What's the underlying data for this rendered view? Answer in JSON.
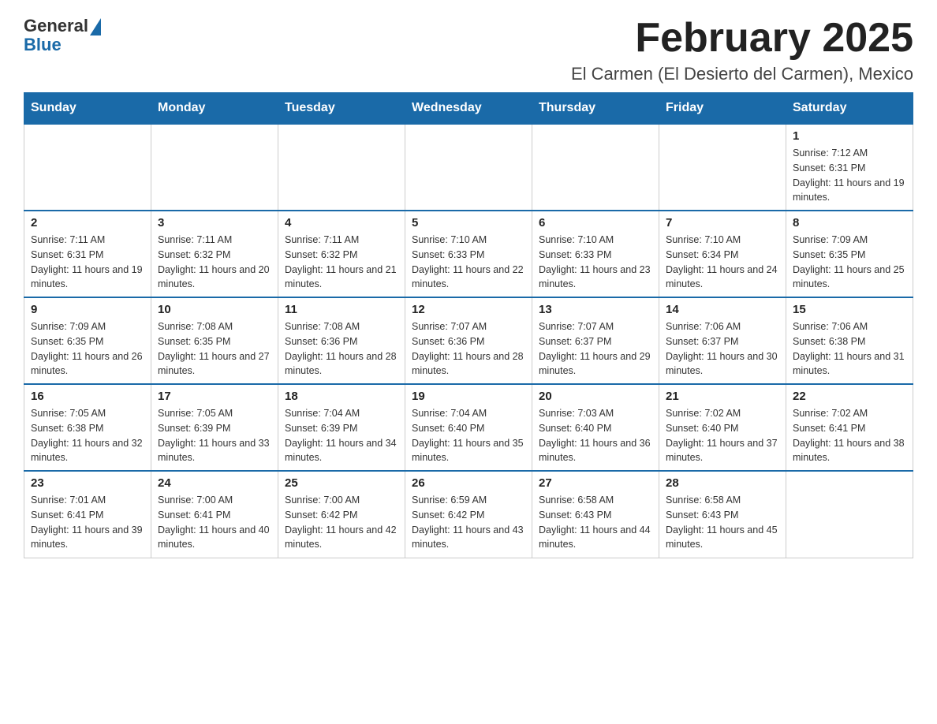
{
  "header": {
    "logo": {
      "general": "General",
      "blue": "Blue"
    },
    "title": "February 2025",
    "location": "El Carmen (El Desierto del Carmen), Mexico"
  },
  "weekdays": [
    "Sunday",
    "Monday",
    "Tuesday",
    "Wednesday",
    "Thursday",
    "Friday",
    "Saturday"
  ],
  "weeks": [
    [
      {
        "day": "",
        "info": ""
      },
      {
        "day": "",
        "info": ""
      },
      {
        "day": "",
        "info": ""
      },
      {
        "day": "",
        "info": ""
      },
      {
        "day": "",
        "info": ""
      },
      {
        "day": "",
        "info": ""
      },
      {
        "day": "1",
        "info": "Sunrise: 7:12 AM\nSunset: 6:31 PM\nDaylight: 11 hours and 19 minutes."
      }
    ],
    [
      {
        "day": "2",
        "info": "Sunrise: 7:11 AM\nSunset: 6:31 PM\nDaylight: 11 hours and 19 minutes."
      },
      {
        "day": "3",
        "info": "Sunrise: 7:11 AM\nSunset: 6:32 PM\nDaylight: 11 hours and 20 minutes."
      },
      {
        "day": "4",
        "info": "Sunrise: 7:11 AM\nSunset: 6:32 PM\nDaylight: 11 hours and 21 minutes."
      },
      {
        "day": "5",
        "info": "Sunrise: 7:10 AM\nSunset: 6:33 PM\nDaylight: 11 hours and 22 minutes."
      },
      {
        "day": "6",
        "info": "Sunrise: 7:10 AM\nSunset: 6:33 PM\nDaylight: 11 hours and 23 minutes."
      },
      {
        "day": "7",
        "info": "Sunrise: 7:10 AM\nSunset: 6:34 PM\nDaylight: 11 hours and 24 minutes."
      },
      {
        "day": "8",
        "info": "Sunrise: 7:09 AM\nSunset: 6:35 PM\nDaylight: 11 hours and 25 minutes."
      }
    ],
    [
      {
        "day": "9",
        "info": "Sunrise: 7:09 AM\nSunset: 6:35 PM\nDaylight: 11 hours and 26 minutes."
      },
      {
        "day": "10",
        "info": "Sunrise: 7:08 AM\nSunset: 6:35 PM\nDaylight: 11 hours and 27 minutes."
      },
      {
        "day": "11",
        "info": "Sunrise: 7:08 AM\nSunset: 6:36 PM\nDaylight: 11 hours and 28 minutes."
      },
      {
        "day": "12",
        "info": "Sunrise: 7:07 AM\nSunset: 6:36 PM\nDaylight: 11 hours and 28 minutes."
      },
      {
        "day": "13",
        "info": "Sunrise: 7:07 AM\nSunset: 6:37 PM\nDaylight: 11 hours and 29 minutes."
      },
      {
        "day": "14",
        "info": "Sunrise: 7:06 AM\nSunset: 6:37 PM\nDaylight: 11 hours and 30 minutes."
      },
      {
        "day": "15",
        "info": "Sunrise: 7:06 AM\nSunset: 6:38 PM\nDaylight: 11 hours and 31 minutes."
      }
    ],
    [
      {
        "day": "16",
        "info": "Sunrise: 7:05 AM\nSunset: 6:38 PM\nDaylight: 11 hours and 32 minutes."
      },
      {
        "day": "17",
        "info": "Sunrise: 7:05 AM\nSunset: 6:39 PM\nDaylight: 11 hours and 33 minutes."
      },
      {
        "day": "18",
        "info": "Sunrise: 7:04 AM\nSunset: 6:39 PM\nDaylight: 11 hours and 34 minutes."
      },
      {
        "day": "19",
        "info": "Sunrise: 7:04 AM\nSunset: 6:40 PM\nDaylight: 11 hours and 35 minutes."
      },
      {
        "day": "20",
        "info": "Sunrise: 7:03 AM\nSunset: 6:40 PM\nDaylight: 11 hours and 36 minutes."
      },
      {
        "day": "21",
        "info": "Sunrise: 7:02 AM\nSunset: 6:40 PM\nDaylight: 11 hours and 37 minutes."
      },
      {
        "day": "22",
        "info": "Sunrise: 7:02 AM\nSunset: 6:41 PM\nDaylight: 11 hours and 38 minutes."
      }
    ],
    [
      {
        "day": "23",
        "info": "Sunrise: 7:01 AM\nSunset: 6:41 PM\nDaylight: 11 hours and 39 minutes."
      },
      {
        "day": "24",
        "info": "Sunrise: 7:00 AM\nSunset: 6:41 PM\nDaylight: 11 hours and 40 minutes."
      },
      {
        "day": "25",
        "info": "Sunrise: 7:00 AM\nSunset: 6:42 PM\nDaylight: 11 hours and 42 minutes."
      },
      {
        "day": "26",
        "info": "Sunrise: 6:59 AM\nSunset: 6:42 PM\nDaylight: 11 hours and 43 minutes."
      },
      {
        "day": "27",
        "info": "Sunrise: 6:58 AM\nSunset: 6:43 PM\nDaylight: 11 hours and 44 minutes."
      },
      {
        "day": "28",
        "info": "Sunrise: 6:58 AM\nSunset: 6:43 PM\nDaylight: 11 hours and 45 minutes."
      },
      {
        "day": "",
        "info": ""
      }
    ]
  ]
}
